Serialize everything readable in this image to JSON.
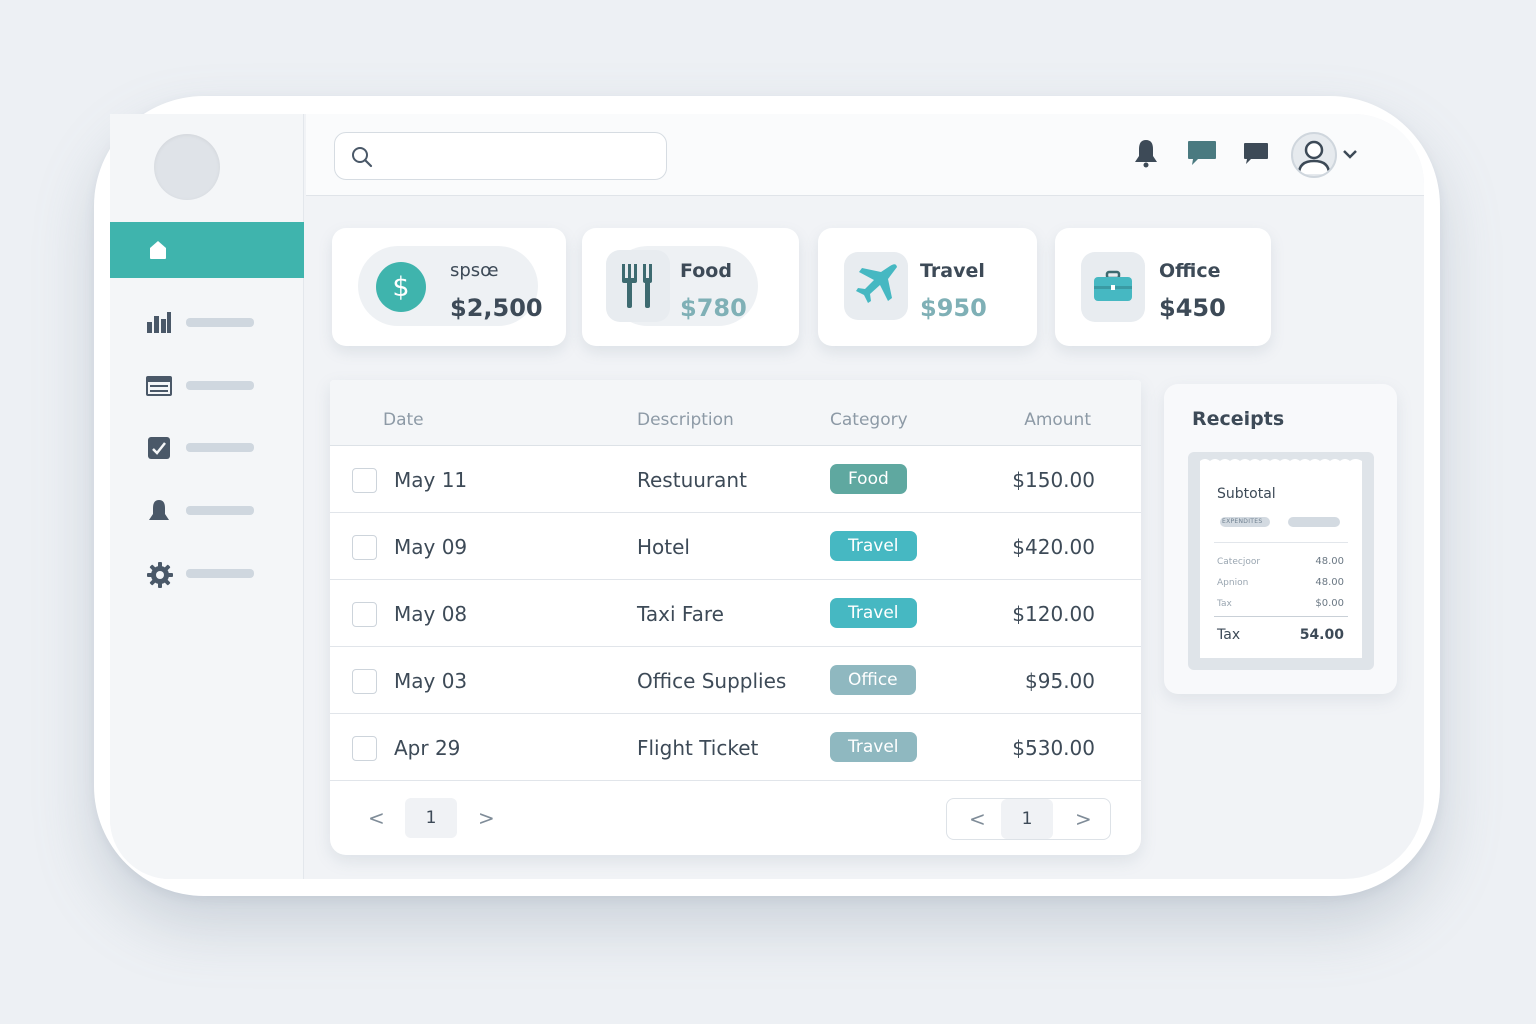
{
  "search": {
    "value": "",
    "placeholder": ""
  },
  "sidebar": {
    "items": [
      {
        "icon": "home-icon"
      },
      {
        "icon": "bar-chart-icon"
      },
      {
        "icon": "list-icon"
      },
      {
        "icon": "checklist-icon"
      },
      {
        "icon": "bell-icon"
      },
      {
        "icon": "gear-icon"
      }
    ],
    "accent": "#3fb4ad"
  },
  "header": {
    "icons": [
      "bell-icon",
      "chat-bubble-icon",
      "message-icon",
      "user-avatar-icon",
      "chevron-down-icon"
    ]
  },
  "summary": [
    {
      "label": "spsœ",
      "value": "$2,500",
      "icon": "dollar-icon",
      "value_color": "#3d4a57"
    },
    {
      "label": "Food",
      "value": "$780",
      "icon": "fork-knife-icon",
      "value_color": "#7fb0b6"
    },
    {
      "label": "Travel",
      "value": "$950",
      "icon": "airplane-icon",
      "value_color": "#7fb0b6"
    },
    {
      "label": "Office",
      "value": "$450",
      "icon": "briefcase-icon",
      "value_color": "#3d4a57"
    }
  ],
  "table": {
    "headers": [
      "Date",
      "Description",
      "Category",
      "Amount"
    ],
    "rows": [
      {
        "date": "May 11",
        "description": "Restuurant",
        "category": "Food",
        "amount": "$150.00",
        "tag_color": "#5fa8a0"
      },
      {
        "date": "May 09",
        "description": "Hotel",
        "category": "Travel",
        "amount": "$420.00",
        "tag_color": "#46b8c2"
      },
      {
        "date": "May 08",
        "description": "Taxi Fare",
        "category": "Travel",
        "amount": "$120.00",
        "tag_color": "#46b8c2"
      },
      {
        "date": "May 03",
        "description": "Office Supplies",
        "category": "Office",
        "amount": "$95.00",
        "tag_color": "#8fb8c0"
      },
      {
        "date": "Apr 29",
        "description": "Flight Ticket",
        "category": "Travel",
        "amount": "$530.00",
        "tag_color": "#8fb8c0"
      }
    ],
    "pager_left": {
      "prev": "<",
      "page": "1",
      "next": ">"
    },
    "pager_right": {
      "prev": "<",
      "page": "1",
      "next": ">"
    }
  },
  "receipts": {
    "title": "Receipts",
    "subtotal_label": "Subtotal",
    "chip_text": "EXPENDITES",
    "lines": [
      {
        "label": "Catecjoor",
        "value": "48.00"
      },
      {
        "label": "Apnion",
        "value": "48.00"
      },
      {
        "label": "Tax",
        "value": "$0.00"
      }
    ],
    "total_label": "Tax",
    "total_value": "54.00"
  }
}
